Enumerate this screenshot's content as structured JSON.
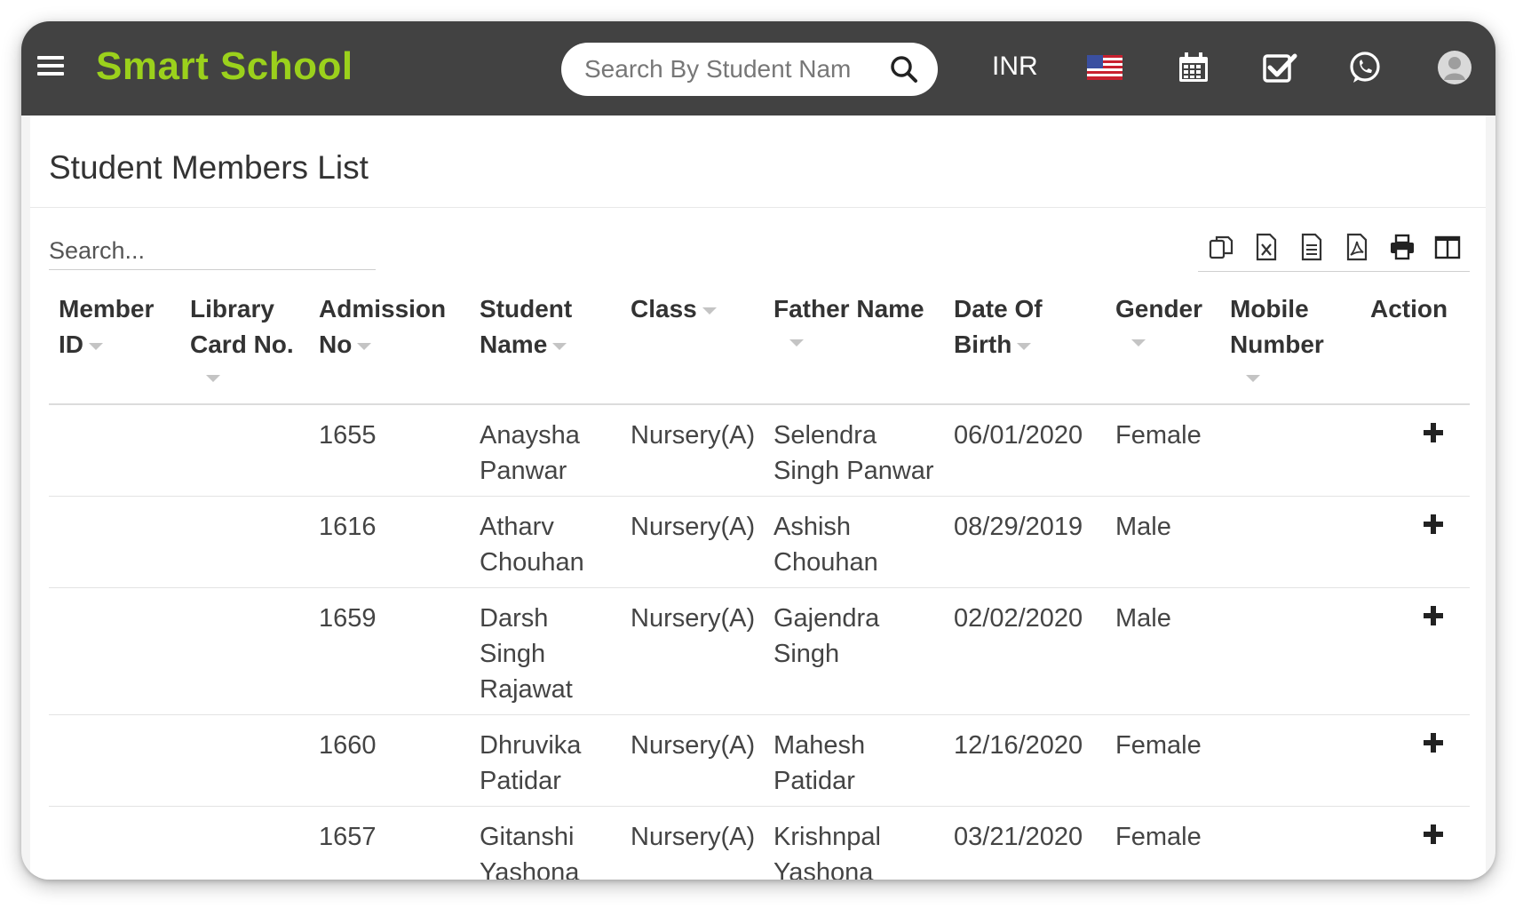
{
  "app": {
    "brand": "Smart School"
  },
  "header": {
    "search_placeholder": "Search By Student Name",
    "currency": "INR",
    "icons": [
      "menu-icon",
      "search-icon",
      "us-flag-icon",
      "calendar-icon",
      "checkbox-icon",
      "whatsapp-icon",
      "user-avatar-icon"
    ]
  },
  "page": {
    "title": "Student Members List",
    "table_search_placeholder": "Search...",
    "toolbar_icons": [
      "copy-icon",
      "excel-icon",
      "csv-icon",
      "pdf-icon",
      "print-icon",
      "columns-icon"
    ]
  },
  "table": {
    "columns": [
      "Member ID",
      "Library Card No.",
      "Admission No",
      "Student Name",
      "Class",
      "Father Name",
      "Date Of Birth",
      "Gender",
      "Mobile Number",
      "Action"
    ],
    "header_lines": [
      [
        "Member",
        "ID"
      ],
      [
        "Library",
        "Card No."
      ],
      [
        "Admission",
        "No"
      ],
      [
        "Student",
        "Name"
      ],
      [
        "Class"
      ],
      [
        "Father Name"
      ],
      [
        "Date Of",
        "Birth"
      ],
      [
        "Gender"
      ],
      [
        "Mobile",
        "Number"
      ],
      [
        "Action"
      ]
    ],
    "rows": [
      {
        "member_id": "",
        "card_no": "",
        "admission_no": "1655",
        "student_name": [
          "Anaysha",
          "Panwar"
        ],
        "class": "Nursery(A)",
        "father_name": [
          "Selendra",
          "Singh Panwar"
        ],
        "dob": "06/01/2020",
        "gender": "Female",
        "mobile": ""
      },
      {
        "member_id": "",
        "card_no": "",
        "admission_no": "1616",
        "student_name": [
          "Atharv",
          "Chouhan"
        ],
        "class": "Nursery(A)",
        "father_name": [
          "Ashish",
          "Chouhan"
        ],
        "dob": "08/29/2019",
        "gender": "Male",
        "mobile": ""
      },
      {
        "member_id": "",
        "card_no": "",
        "admission_no": "1659",
        "student_name": [
          "Darsh",
          "Singh",
          "Rajawat"
        ],
        "class": "Nursery(A)",
        "father_name": [
          "Gajendra",
          "Singh"
        ],
        "dob": "02/02/2020",
        "gender": "Male",
        "mobile": ""
      },
      {
        "member_id": "",
        "card_no": "",
        "admission_no": "1660",
        "student_name": [
          "Dhruvika",
          "Patidar"
        ],
        "class": "Nursery(A)",
        "father_name": [
          "Mahesh",
          "Patidar"
        ],
        "dob": "12/16/2020",
        "gender": "Female",
        "mobile": ""
      },
      {
        "member_id": "",
        "card_no": "",
        "admission_no": "1657",
        "student_name": [
          "Gitanshi",
          "Yashona"
        ],
        "class": "Nursery(A)",
        "father_name": [
          "Krishnpal",
          "Yashona"
        ],
        "dob": "03/21/2020",
        "gender": "Female",
        "mobile": ""
      }
    ]
  },
  "colors": {
    "topbar": "#424242",
    "brand": "#9bd11c",
    "text": "#333333"
  }
}
